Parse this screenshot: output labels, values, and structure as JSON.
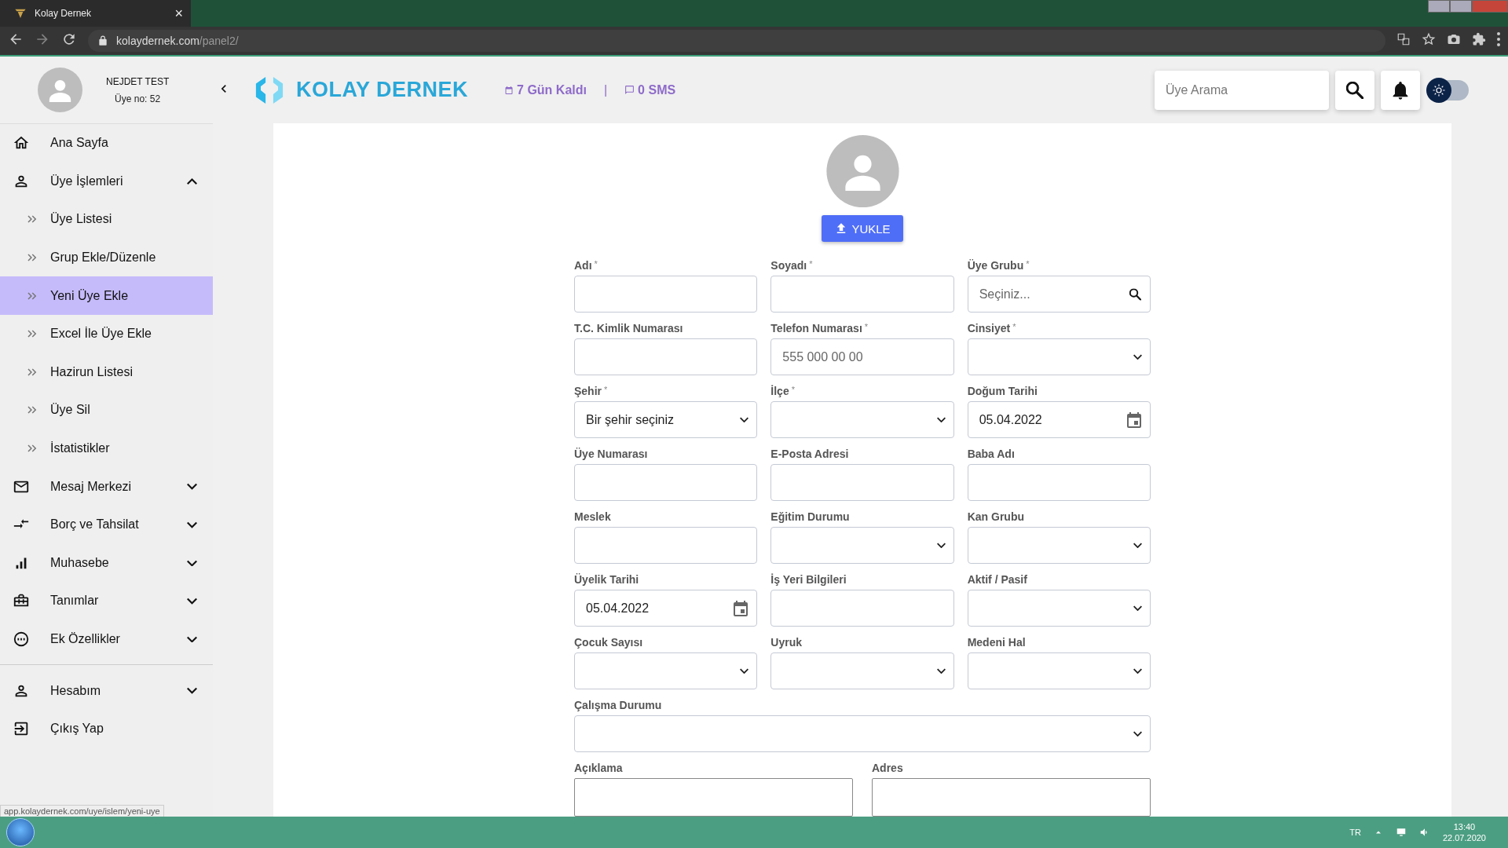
{
  "browser": {
    "tab_title": "Kolay Dernek",
    "tab_close": "×",
    "url_host": "kolaydernek.com",
    "url_path": "/panel2/"
  },
  "header": {
    "user_name": "NEJDET TEST",
    "member_no": "Üye no: 52",
    "brand": "KOLAY DERNEK",
    "days_left": "7 Gün Kaldı",
    "separator": "|",
    "sms": "0 SMS",
    "search": {
      "placeholder": "Üye Arama"
    },
    "theme_toggle": {
      "on": false
    }
  },
  "sidebar": {
    "sections": [
      {
        "items": [
          {
            "label": "Ana Sayfa"
          },
          {
            "label": "Üye İşlemleri",
            "expanded": true,
            "children": [
              {
                "label": "Üye Listesi",
                "selected": false
              },
              {
                "label": "Grup Ekle/Düzenle",
                "selected": false
              },
              {
                "label": "Yeni Üye Ekle",
                "selected": true
              },
              {
                "label": "Excel İle Üye Ekle",
                "selected": false
              },
              {
                "label": "Hazirun Listesi",
                "selected": false
              },
              {
                "label": "Üye Sil",
                "selected": false
              },
              {
                "label": "İstatistikler",
                "selected": false
              }
            ]
          },
          {
            "label": "Mesaj Merkezi",
            "expanded": false
          },
          {
            "label": "Borç ve Tahsilat",
            "expanded": false
          },
          {
            "label": "Muhasebe",
            "expanded": false
          },
          {
            "label": "Tanımlar",
            "expanded": false
          },
          {
            "label": "Ek Özellikler",
            "expanded": false
          }
        ]
      },
      {
        "items": [
          {
            "label": "Hesabım",
            "expanded": false
          },
          {
            "label": "Çıkış Yap"
          }
        ]
      }
    ]
  },
  "form": {
    "upload_button": "YUKLE",
    "rows": [
      [
        {
          "label": "Adı",
          "required_mark": "*",
          "kind": "text"
        },
        {
          "label": "Soyadı",
          "required_mark": "*",
          "kind": "text"
        },
        {
          "label": "Üye Grubu",
          "required_mark": "*",
          "kind": "search",
          "placeholder": "Seçiniz..."
        }
      ],
      [
        {
          "label": "T.C. Kimlik Numarası",
          "kind": "text"
        },
        {
          "label": "Telefon Numarası",
          "required_mark": "*",
          "kind": "text",
          "placeholder": "555 000 00 00"
        },
        {
          "label": "Cinsiyet",
          "required_mark": "*",
          "kind": "select"
        }
      ],
      [
        {
          "label": "Şehir",
          "required_mark": "*",
          "kind": "select",
          "value": "Bir şehir seçiniz"
        },
        {
          "label": "İlçe",
          "required_mark": "*",
          "kind": "select"
        },
        {
          "label": "Doğum Tarihi",
          "kind": "date",
          "value": "05.04.2022"
        }
      ],
      [
        {
          "label": "Üye Numarası",
          "kind": "text"
        },
        {
          "label": "E-Posta Adresi",
          "kind": "text"
        },
        {
          "label": "Baba Adı",
          "kind": "text"
        }
      ],
      [
        {
          "label": "Meslek",
          "kind": "text"
        },
        {
          "label": "Eğitim Durumu",
          "kind": "select"
        },
        {
          "label": "Kan Grubu",
          "kind": "select"
        }
      ],
      [
        {
          "label": "Üyelik Tarihi",
          "kind": "date",
          "value": "05.04.2022"
        },
        {
          "label": "İş Yeri Bilgileri",
          "kind": "text"
        },
        {
          "label": "Aktif / Pasif",
          "kind": "select"
        }
      ],
      [
        {
          "label": "Çocuk Sayısı",
          "kind": "select"
        },
        {
          "label": "Uyruk",
          "kind": "select"
        },
        {
          "label": "Medeni Hal",
          "kind": "select"
        }
      ],
      [
        {
          "label": "Çalışma Durumu",
          "kind": "select"
        }
      ],
      [
        {
          "label": "Açıklama",
          "kind": "textarea"
        },
        {
          "label": "Adres",
          "kind": "textarea"
        }
      ]
    ]
  },
  "status_link": "app.kolaydernek.com/uye/islem/yeni-uye",
  "taskbar": {
    "language": "TR",
    "time": "13:40",
    "date": "22.07.2020"
  }
}
